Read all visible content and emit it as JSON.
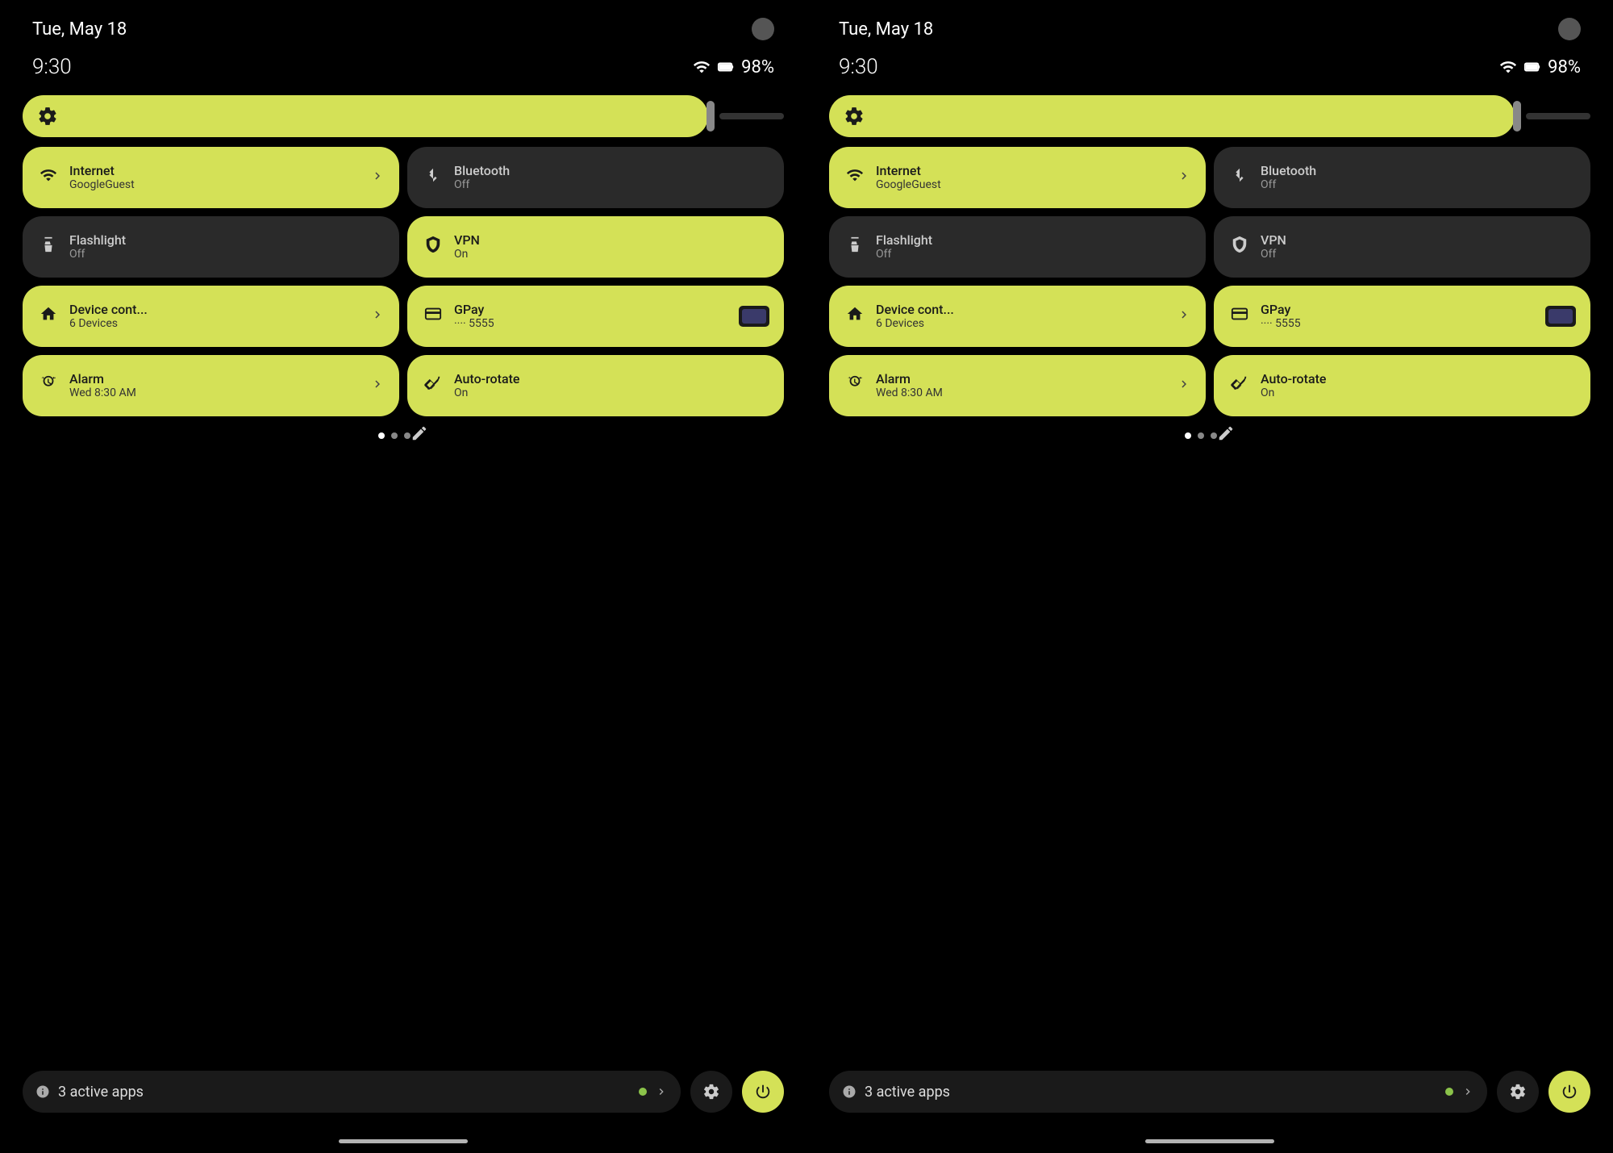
{
  "panels": [
    {
      "id": "panel-left",
      "statusBar": {
        "date": "Tue, May 18",
        "time": "9:30",
        "battery": "98%",
        "wifiIcon": "wifi",
        "batteryIcon": "battery"
      },
      "brightness": {
        "ariaLabel": "Brightness slider"
      },
      "tiles": [
        {
          "id": "internet",
          "label": "Internet",
          "sub": "GoogleGuest",
          "state": "active",
          "icon": "wifi",
          "hasChevron": true
        },
        {
          "id": "bluetooth",
          "label": "Bluetooth",
          "sub": "Off",
          "state": "inactive",
          "icon": "bluetooth",
          "hasChevron": false
        },
        {
          "id": "flashlight",
          "label": "Flashlight",
          "sub": "Off",
          "state": "inactive",
          "icon": "flashlight",
          "hasChevron": false
        },
        {
          "id": "vpn",
          "label": "VPN",
          "sub": "On",
          "state": "active",
          "icon": "vpn",
          "hasChevron": false
        },
        {
          "id": "device-control",
          "label": "Device cont...",
          "sub": "6 Devices",
          "state": "active",
          "icon": "home",
          "hasChevron": true
        },
        {
          "id": "gpay",
          "label": "GPay",
          "sub": "···· 5555",
          "state": "active",
          "icon": "gpay",
          "hasChevron": false,
          "hasCard": true
        },
        {
          "id": "alarm",
          "label": "Alarm",
          "sub": "Wed 8:30 AM",
          "state": "active",
          "icon": "alarm",
          "hasChevron": true
        },
        {
          "id": "auto-rotate",
          "label": "Auto-rotate",
          "sub": "On",
          "state": "active",
          "icon": "rotate",
          "hasChevron": false
        }
      ],
      "dots": [
        {
          "active": true
        },
        {
          "active": false
        },
        {
          "active": false
        }
      ],
      "bottomBar": {
        "activeAppsCount": "3",
        "activeAppsLabel": "active apps",
        "gearIcon": "gear",
        "powerIcon": "power"
      }
    },
    {
      "id": "panel-right",
      "statusBar": {
        "date": "Tue, May 18",
        "time": "9:30",
        "battery": "98%",
        "wifiIcon": "wifi",
        "batteryIcon": "battery"
      },
      "brightness": {
        "ariaLabel": "Brightness slider"
      },
      "tiles": [
        {
          "id": "internet",
          "label": "Internet",
          "sub": "GoogleGuest",
          "state": "active",
          "icon": "wifi",
          "hasChevron": true
        },
        {
          "id": "bluetooth",
          "label": "Bluetooth",
          "sub": "Off",
          "state": "inactive",
          "icon": "bluetooth",
          "hasChevron": false
        },
        {
          "id": "flashlight",
          "label": "Flashlight",
          "sub": "Off",
          "state": "inactive",
          "icon": "flashlight",
          "hasChevron": false
        },
        {
          "id": "vpn",
          "label": "VPN",
          "sub": "Off",
          "state": "inactive",
          "icon": "vpn",
          "hasChevron": false
        },
        {
          "id": "device-control",
          "label": "Device cont...",
          "sub": "6 Devices",
          "state": "active",
          "icon": "home",
          "hasChevron": true
        },
        {
          "id": "gpay",
          "label": "GPay",
          "sub": "···· 5555",
          "state": "active",
          "icon": "gpay",
          "hasChevron": false,
          "hasCard": true
        },
        {
          "id": "alarm",
          "label": "Alarm",
          "sub": "Wed 8:30 AM",
          "state": "active",
          "icon": "alarm",
          "hasChevron": true
        },
        {
          "id": "auto-rotate",
          "label": "Auto-rotate",
          "sub": "On",
          "state": "active",
          "icon": "rotate",
          "hasChevron": false
        }
      ],
      "dots": [
        {
          "active": true
        },
        {
          "active": false
        },
        {
          "active": false
        }
      ],
      "bottomBar": {
        "activeAppsCount": "3",
        "activeAppsLabel": "active apps",
        "gearIcon": "gear",
        "powerIcon": "power"
      }
    }
  ]
}
